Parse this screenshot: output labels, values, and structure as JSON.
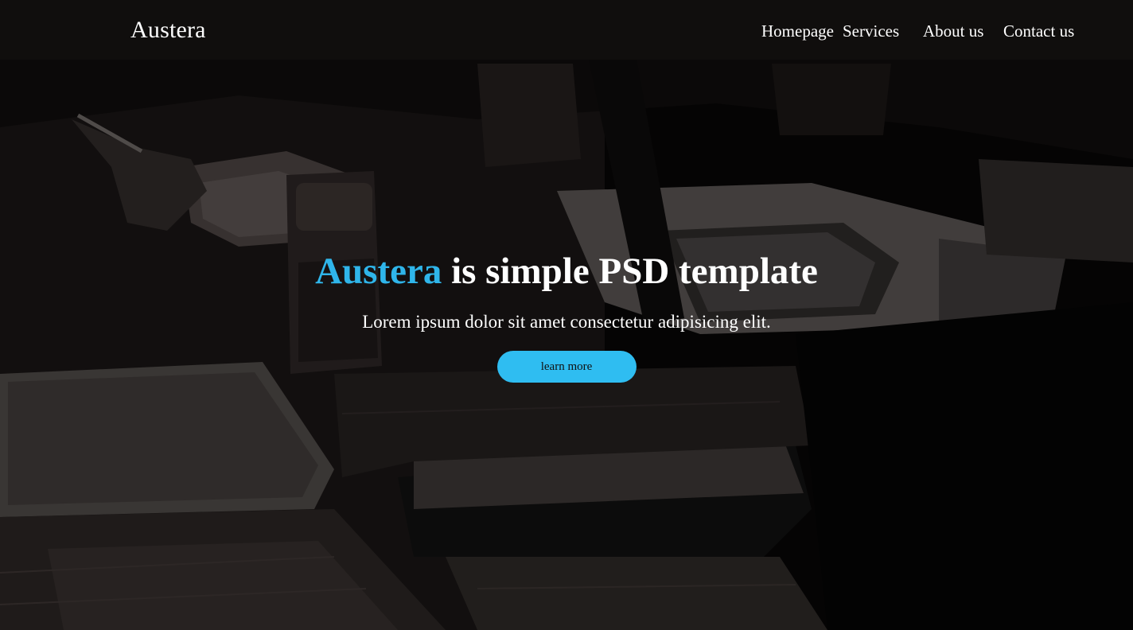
{
  "navbar": {
    "brand": "Austera",
    "links": [
      "Homepage",
      "Services",
      "About us",
      "Contact us"
    ]
  },
  "hero": {
    "title_accent": "Austera",
    "title_rest": " is simple PSD template",
    "subtitle": "Lorem ipsum dolor sit amet consectetur adipisicing elit.",
    "button_label": "learn more"
  },
  "colors": {
    "accent": "#2fb5ea",
    "button": "#2fbdf1",
    "navbar_overlay": "rgba(26,24,22,0.55)",
    "text": "#ffffff"
  }
}
